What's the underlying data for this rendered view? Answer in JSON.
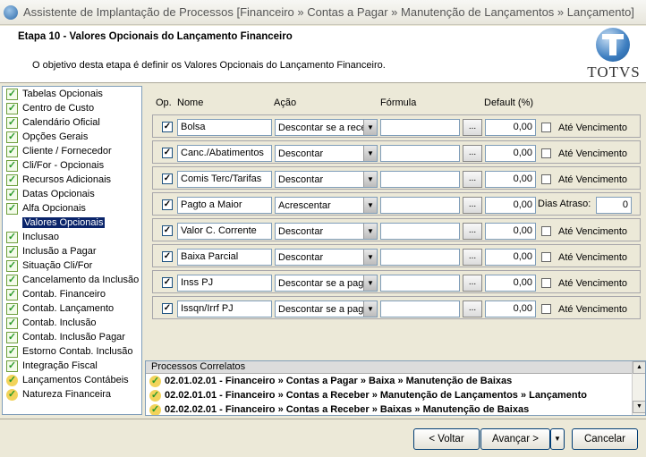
{
  "window": {
    "title": "Assistente de Implantação de Processos [Financeiro » Contas a Pagar » Manutenção de Lançamentos » Lançamento]"
  },
  "header": {
    "step_title": "Etapa 10 - Valores Opcionais do Lançamento Financeiro",
    "description": "O objetivo desta etapa é definir os Valores Opcionais do Lançamento Financeiro.",
    "logo_text": "TOTVS"
  },
  "nav": {
    "items": [
      {
        "label": "Tabelas Opcionais",
        "status": "done"
      },
      {
        "label": "Centro de Custo",
        "status": "done"
      },
      {
        "label": "Calendário Oficial",
        "status": "done"
      },
      {
        "label": "Opções Gerais",
        "status": "done"
      },
      {
        "label": "Cliente / Fornecedor",
        "status": "done"
      },
      {
        "label": "Cli/For - Opcionais",
        "status": "done"
      },
      {
        "label": "Recursos Adicionais",
        "status": "done"
      },
      {
        "label": "Datas Opcionais",
        "status": "done"
      },
      {
        "label": "Alfa Opcionais",
        "status": "done"
      },
      {
        "label": "Valores Opcionais",
        "status": "current"
      },
      {
        "label": "Inclusao",
        "status": "done"
      },
      {
        "label": "Inclusão a Pagar",
        "status": "done"
      },
      {
        "label": "Situação Cli/For",
        "status": "done"
      },
      {
        "label": "Cancelamento da Inclusão",
        "status": "done"
      },
      {
        "label": "Contab. Financeiro",
        "status": "done"
      },
      {
        "label": "Contab. Lançamento",
        "status": "done"
      },
      {
        "label": "Contab. Inclusão",
        "status": "done"
      },
      {
        "label": "Contab. Inclusão Pagar",
        "status": "done"
      },
      {
        "label": "Estorno Contab. Inclusão",
        "status": "done"
      },
      {
        "label": "Integração Fiscal",
        "status": "done"
      },
      {
        "label": "Lançamentos Contábeis",
        "status": "mixed"
      },
      {
        "label": "Natureza Financeira",
        "status": "mixed"
      }
    ]
  },
  "columns": {
    "op": "Op.",
    "nome": "Nome",
    "acao": "Ação",
    "formula": "Fórmula",
    "default": "Default (%)"
  },
  "rows": [
    {
      "checked": true,
      "nome": "Bolsa",
      "acao": "Descontar se a rece",
      "formula": "",
      "default": "0,00",
      "extra": "Até Vencimento"
    },
    {
      "checked": true,
      "nome": "Canc./Abatimentos",
      "acao": "Descontar",
      "formula": "",
      "default": "0,00",
      "extra": "Até Vencimento"
    },
    {
      "checked": true,
      "nome": "Comis Terc/Tarifas",
      "acao": "Descontar",
      "formula": "",
      "default": "0,00",
      "extra": "Até Vencimento"
    },
    {
      "checked": true,
      "nome": "Pagto a Maior",
      "acao": "Acrescentar",
      "formula": "",
      "default": "0,00",
      "dias_label": "Dias Atraso:",
      "dias_value": "0"
    },
    {
      "checked": true,
      "nome": "Valor C. Corrente",
      "acao": "Descontar",
      "formula": "",
      "default": "0,00",
      "extra": "Até Vencimento"
    },
    {
      "checked": true,
      "nome": "Baixa Parcial",
      "acao": "Descontar",
      "formula": "",
      "default": "0,00",
      "extra": "Até Vencimento"
    },
    {
      "checked": true,
      "nome": "Inss PJ",
      "acao": "Descontar se a pag",
      "formula": "",
      "default": "0,00",
      "extra": "Até Vencimento"
    },
    {
      "checked": true,
      "nome": "Issqn/Irrf PJ",
      "acao": "Descontar se a pag",
      "formula": "",
      "default": "0,00",
      "extra": "Até Vencimento"
    }
  ],
  "processos": {
    "title": "Processos Correlatos",
    "items": [
      "02.01.02.01 - Financeiro » Contas a Pagar » Baixa » Manutenção de Baixas",
      "02.02.01.01 - Financeiro » Contas a Receber » Manutenção de Lançamentos » Lançamento",
      "02.02.02.01 - Financeiro » Contas a Receber » Baixas » Manutenção de Baixas"
    ]
  },
  "buttons": {
    "back": "< Voltar",
    "next": "Avançar >",
    "cancel": "Cancelar",
    "dots": "..."
  }
}
